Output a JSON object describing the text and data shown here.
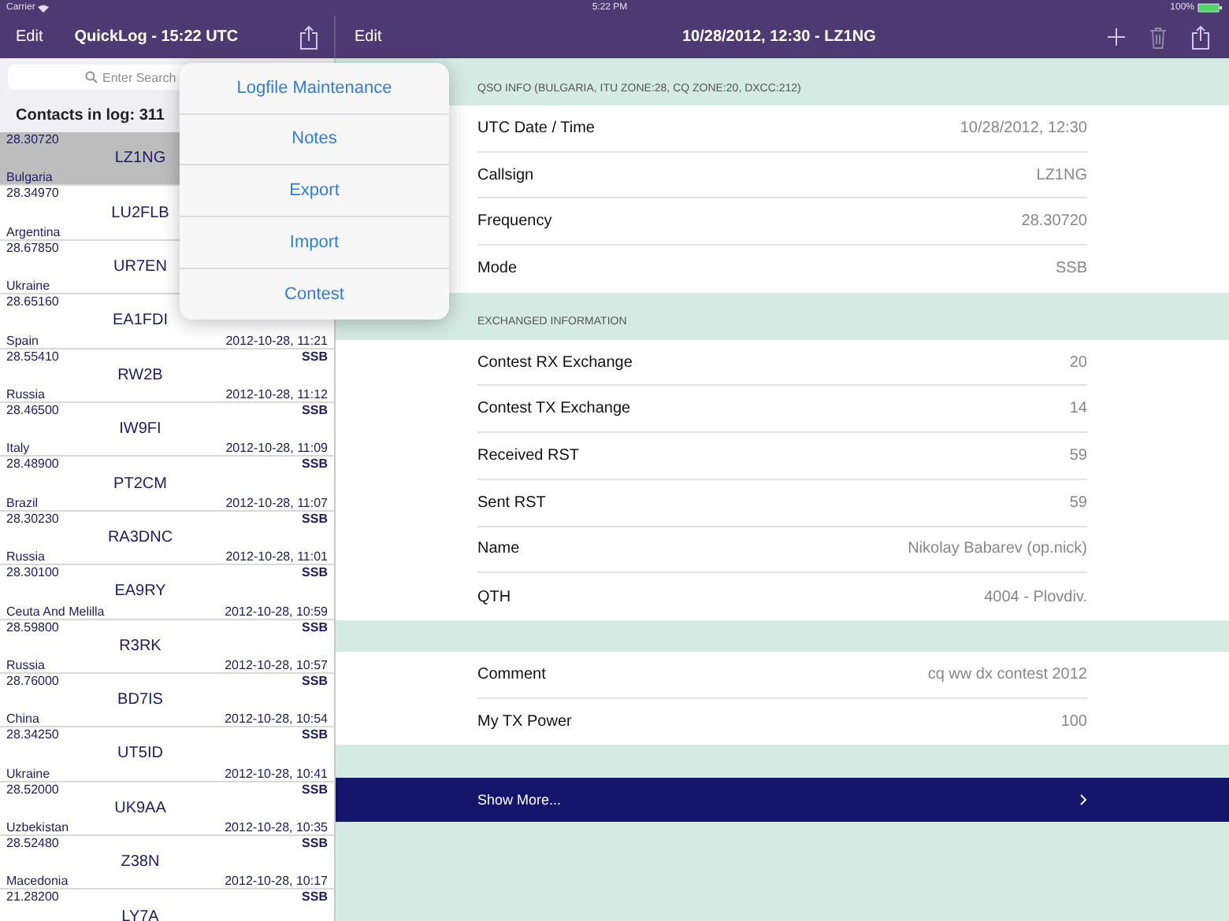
{
  "status_bar": {
    "carrier": "Carrier",
    "time": "5:22 PM",
    "battery": "100%"
  },
  "left_nav": {
    "edit": "Edit",
    "title": "QuickLog - 15:22 UTC"
  },
  "search": {
    "placeholder": "Enter Search"
  },
  "contacts_count": "Contacts in log: 311",
  "contacts": [
    {
      "frequency": "28.30720",
      "callsign": "LZ1NG",
      "country": "Bulgaria",
      "selected": true
    },
    {
      "frequency": "28.34970",
      "callsign": "LU2FLB",
      "country": "Argentina",
      "selected": false
    },
    {
      "frequency": "28.67850",
      "callsign": "UR7EN",
      "country": "Ukraine",
      "selected": false
    },
    {
      "frequency": "28.65160",
      "callsign": "EA1FDI",
      "country": "Spain",
      "datetime": "2012-10-28, 11:21",
      "selected": false
    },
    {
      "frequency": "28.55410",
      "mode": "SSB",
      "callsign": "RW2B",
      "country": "Russia",
      "datetime": "2012-10-28, 11:12",
      "selected": false
    },
    {
      "frequency": "28.46500",
      "mode": "SSB",
      "callsign": "IW9FI",
      "country": "Italy",
      "datetime": "2012-10-28, 11:09",
      "selected": false
    },
    {
      "frequency": "28.48900",
      "mode": "SSB",
      "callsign": "PT2CM",
      "country": "Brazil",
      "datetime": "2012-10-28, 11:07",
      "selected": false
    },
    {
      "frequency": "28.30230",
      "mode": "SSB",
      "callsign": "RA3DNC",
      "country": "Russia",
      "datetime": "2012-10-28, 11:01",
      "selected": false
    },
    {
      "frequency": "28.30100",
      "mode": "SSB",
      "callsign": "EA9RY",
      "country": "Ceuta And Melilla",
      "datetime": "2012-10-28, 10:59",
      "selected": false
    },
    {
      "frequency": "28.59800",
      "mode": "SSB",
      "callsign": "R3RK",
      "country": "Russia",
      "datetime": "2012-10-28, 10:57",
      "selected": false
    },
    {
      "frequency": "28.76000",
      "mode": "SSB",
      "callsign": "BD7IS",
      "country": "China",
      "datetime": "2012-10-28, 10:54",
      "selected": false
    },
    {
      "frequency": "28.34250",
      "mode": "SSB",
      "callsign": "UT5ID",
      "country": "Ukraine",
      "datetime": "2012-10-28, 10:41",
      "selected": false
    },
    {
      "frequency": "28.52000",
      "mode": "SSB",
      "callsign": "UK9AA",
      "country": "Uzbekistan",
      "datetime": "2012-10-28, 10:35",
      "selected": false
    },
    {
      "frequency": "28.52480",
      "mode": "SSB",
      "callsign": "Z38N",
      "country": "Macedonia",
      "datetime": "2012-10-28, 10:17",
      "selected": false
    },
    {
      "frequency": "21.28200",
      "mode": "SSB",
      "callsign": "LY7A",
      "selected": false
    }
  ],
  "menu": [
    "Logfile Maintenance",
    "Notes",
    "Export",
    "Import",
    "Contest"
  ],
  "detail_nav": {
    "edit": "Edit",
    "title": "10/28/2012, 12:30 - LZ1NG"
  },
  "sections": [
    {
      "header": "QSO INFO (BULGARIA, ITU ZONE:28, CQ ZONE:20, DXCC:212)",
      "rows": [
        {
          "label": "UTC Date / Time",
          "value": "10/28/2012, 12:30"
        },
        {
          "label": "Callsign",
          "value": "LZ1NG"
        },
        {
          "label": "Frequency",
          "value": "28.30720"
        },
        {
          "label": "Mode",
          "value": "SSB"
        }
      ]
    },
    {
      "header": "EXCHANGED INFORMATION",
      "rows": [
        {
          "label": "Contest RX Exchange",
          "value": "20"
        },
        {
          "label": "Contest TX Exchange",
          "value": "14"
        },
        {
          "label": "Received RST",
          "value": "59"
        },
        {
          "label": "Sent RST",
          "value": "59"
        },
        {
          "label": "Name",
          "value": "Nikolay Babarev (op.nick)"
        },
        {
          "label": "QTH",
          "value": "4004 - Plovdiv."
        }
      ]
    },
    {
      "rows": [
        {
          "label": "Comment",
          "value": "cq ww dx contest 2012"
        },
        {
          "label": "My TX Power",
          "value": "100"
        }
      ]
    }
  ],
  "show_more": "Show More..."
}
